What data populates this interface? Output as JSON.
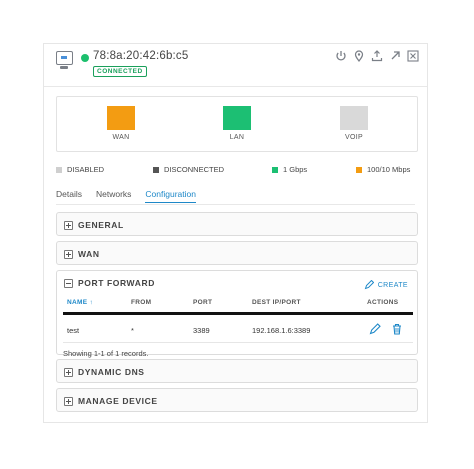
{
  "device": {
    "mac": "78:8a:20:42:6b:c5",
    "status": "CONNECTED"
  },
  "ports": [
    {
      "label": "WAN",
      "color": "#f39c12"
    },
    {
      "label": "LAN",
      "color": "#1cbf73"
    },
    {
      "label": "VOIP",
      "color": "#d9d9d9"
    }
  ],
  "legend": [
    {
      "label": "DISABLED",
      "color": "#cfcfcf"
    },
    {
      "label": "DISCONNECTED",
      "color": "#555555"
    },
    {
      "label": "1 Gbps",
      "color": "#1cbf73"
    },
    {
      "label": "100/10 Mbps",
      "color": "#f39c12"
    }
  ],
  "tabs": [
    {
      "label": "Details",
      "active": false
    },
    {
      "label": "Networks",
      "active": false
    },
    {
      "label": "Configuration",
      "active": true
    }
  ],
  "sections": {
    "general": "GENERAL",
    "wan": "WAN",
    "port_forward": "PORT FORWARD",
    "dynamic_dns": "DYNAMIC DNS",
    "manage_device": "MANAGE DEVICE"
  },
  "port_forward": {
    "create_label": "CREATE",
    "columns": [
      "NAME",
      "FROM",
      "PORT",
      "DEST IP/PORT",
      "ACTIONS"
    ],
    "sort_indicator": "↑",
    "rows": [
      {
        "name": "test",
        "from": "*",
        "port": "3389",
        "dest": "192.168.1.6:3389"
      }
    ],
    "footer": "Showing 1-1 of 1 records."
  },
  "icons": {
    "accent": "#1e88c8"
  }
}
